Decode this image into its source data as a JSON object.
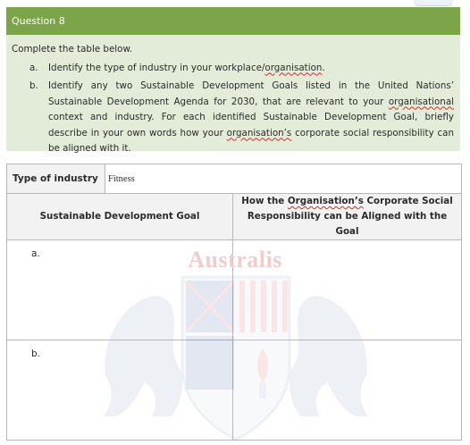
{
  "question": {
    "title": "Question 8",
    "instruction": "Complete the table below.",
    "tasks": [
      {
        "marker": "a.",
        "text_before": "Identify the type of industry in your workplace/",
        "spell_word": "organisation",
        "text_after": "."
      },
      {
        "marker": "b.",
        "text_part1": "Identify any two Sustainable Development Goals listed in the United Nations’ Sustainable Development Agenda for 2030, that are relevant to your ",
        "spell_word1": "organisational",
        "text_part2": " context and industry. For each identified Sustainable Development Goal, briefly describe in your own words how your ",
        "spell_word2": "organisation’s",
        "text_part3": " corporate social responsibility can be aligned with it."
      }
    ]
  },
  "table": {
    "industry_label": "Type of industry",
    "industry_value": "Fitness",
    "col1_header": "Sustainable Development Goal",
    "col2_header_before": "How the ",
    "col2_header_spell": "Organisation’s",
    "col2_header_after": " Corporate Social Responsibility can be Aligned with the Goal",
    "rows": [
      {
        "marker": "a.",
        "goal": "",
        "alignment": ""
      },
      {
        "marker": "b.",
        "goal": "",
        "alignment": ""
      }
    ]
  },
  "watermark": {
    "text": "Australis"
  },
  "colors": {
    "header_green": "#7ca54a",
    "body_green": "#e2ecd8",
    "header_cell_grey": "#f2f2f2",
    "spell_underline": "#d22d2d"
  }
}
